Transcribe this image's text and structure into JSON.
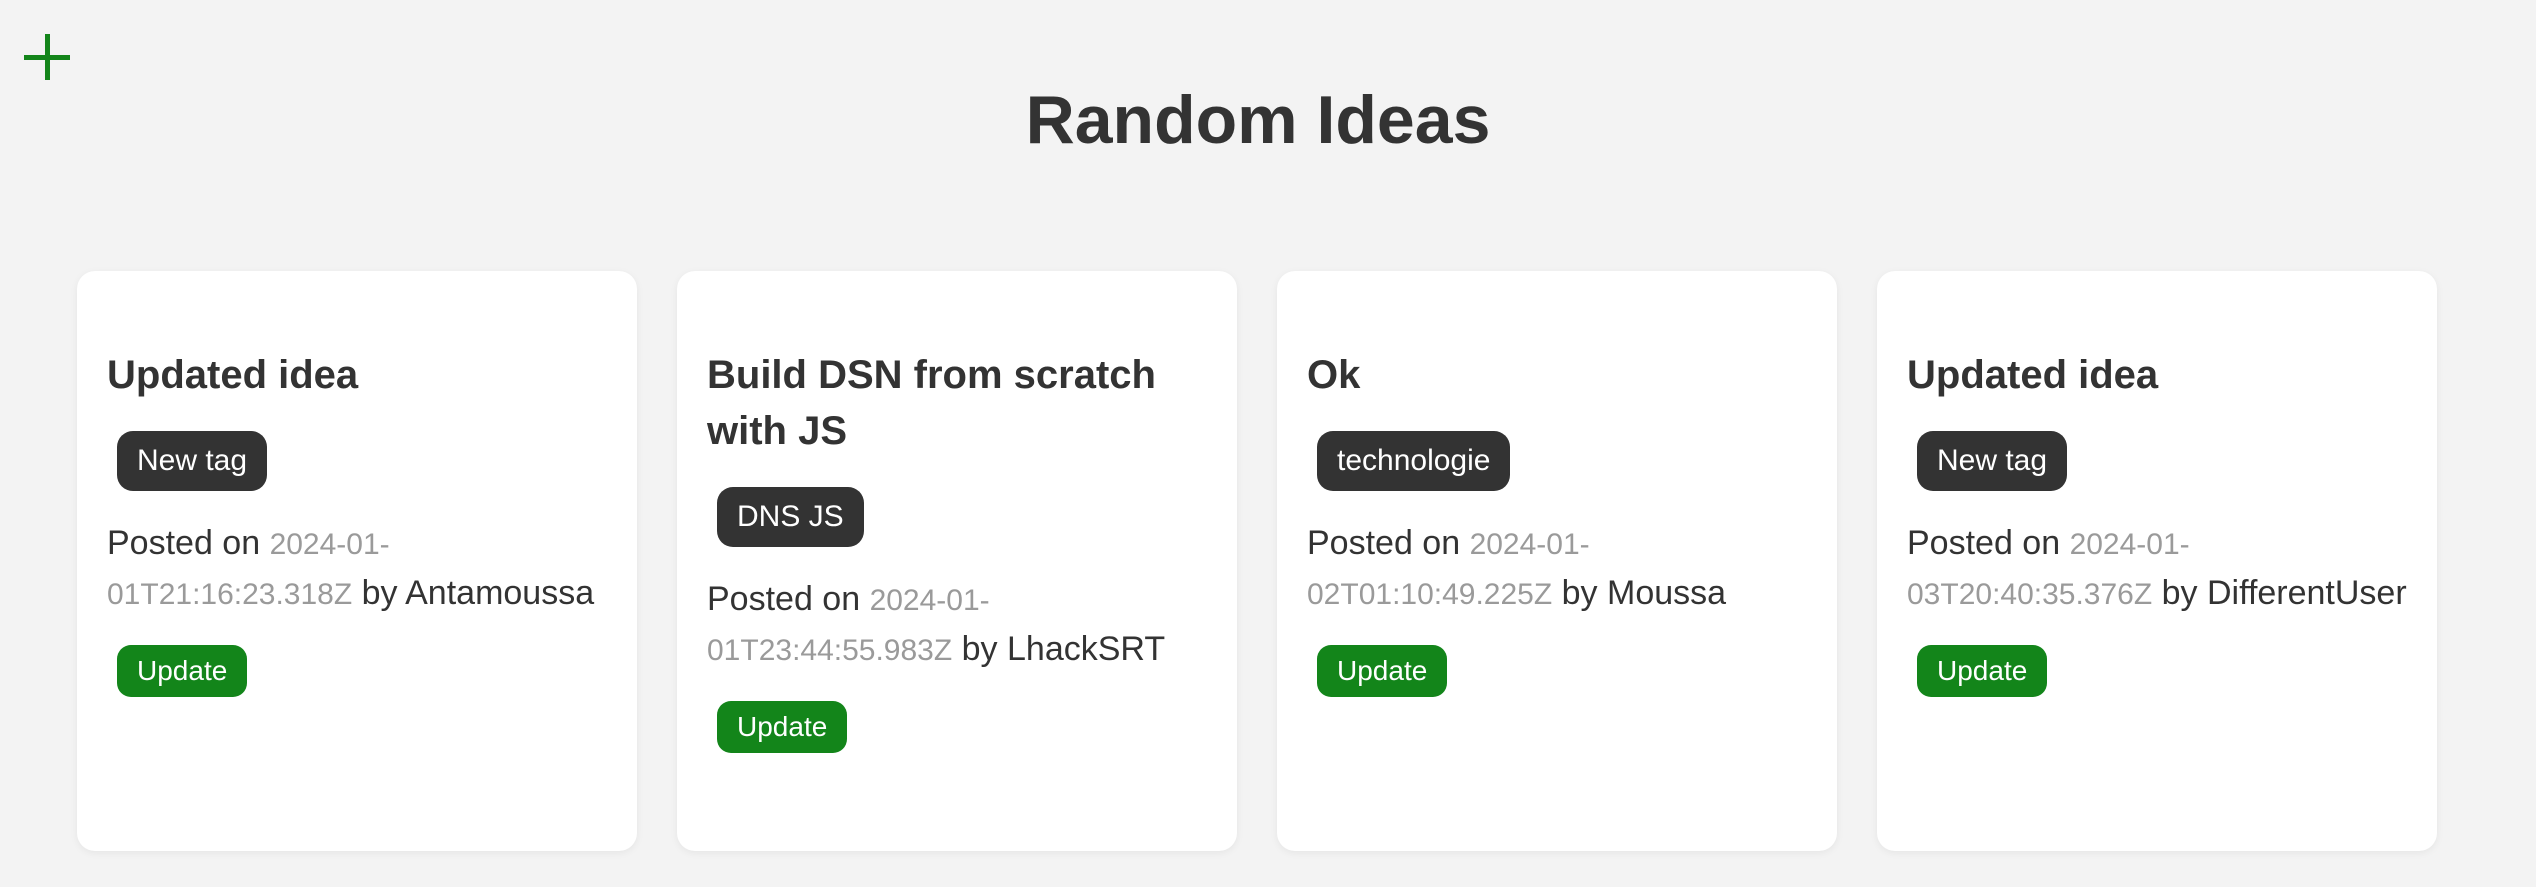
{
  "header": {
    "title": "Random Ideas",
    "add_icon": "plus-icon"
  },
  "colors": {
    "background": "#f3f3f3",
    "accent": "#13851a",
    "tag_bg": "#333333",
    "date_text": "#9a9a9a"
  },
  "ideas": [
    {
      "title": "Updated idea",
      "tag": "New tag",
      "posted_prefix": "Posted on ",
      "date": "2024-01-01T21:16:23.318Z",
      "by_prefix": " by ",
      "author": "Antamoussa",
      "update_label": "Update"
    },
    {
      "title": "Build DSN from scratch with JS",
      "tag": "DNS JS",
      "posted_prefix": "Posted on ",
      "date": "2024-01-01T23:44:55.983Z",
      "by_prefix": " by ",
      "author": "LhackSRT",
      "update_label": "Update"
    },
    {
      "title": "Ok",
      "tag": "technologie",
      "posted_prefix": "Posted on ",
      "date": "2024-01-02T01:10:49.225Z",
      "by_prefix": " by ",
      "author": "Moussa",
      "update_label": "Update"
    },
    {
      "title": "Updated idea",
      "tag": "New tag",
      "posted_prefix": "Posted on ",
      "date": "2024-01-03T20:40:35.376Z",
      "by_prefix": " by ",
      "author": "DifferentUser",
      "update_label": "Update"
    }
  ]
}
